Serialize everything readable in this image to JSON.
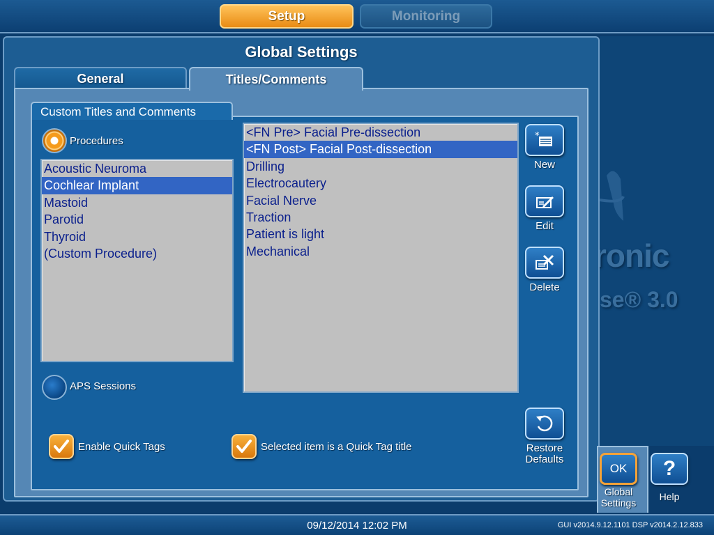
{
  "top_tabs": {
    "setup": "Setup",
    "monitoring": "Monitoring"
  },
  "background": {
    "brand_fragment": "ronic",
    "version_fragment": "se® 3.0"
  },
  "panel": {
    "title": "Global Settings",
    "tabs": {
      "general": "General",
      "titles_comments": "Titles/Comments"
    },
    "group_title": "Custom Titles and Comments"
  },
  "radios": {
    "procedures": "Procedures",
    "aps_sessions": "APS Sessions"
  },
  "procedures": {
    "items": [
      "Acoustic Neuroma",
      "Cochlear Implant",
      "Mastoid",
      "Parotid",
      "Thyroid",
      "(Custom Procedure)"
    ],
    "selected": "Cochlear Implant"
  },
  "titles": {
    "items": [
      "<FN Pre> Facial Pre-dissection",
      "<FN Post> Facial Post-dissection",
      "Drilling",
      "Electrocautery",
      "Facial Nerve",
      "Traction",
      "Patient is light",
      "Mechanical"
    ],
    "selected": "<FN Post> Facial Post-dissection"
  },
  "buttons": {
    "new": "New",
    "edit": "Edit",
    "delete": "Delete",
    "restore_line1": "Restore",
    "restore_line2": "Defaults",
    "ok": "OK",
    "global_line1": "Global",
    "global_line2": "Settings",
    "help_glyph": "?",
    "help": "Help"
  },
  "checkboxes": {
    "enable_quick_tags": "Enable Quick Tags",
    "quick_tag_title": "Selected item is a Quick Tag title"
  },
  "status": {
    "datetime": "09/12/2014 12:02 PM",
    "versions": "GUI v2014.9.12.1101   DSP v2014.2.12.833"
  },
  "colors": {
    "accent": "#f59b1c",
    "background": "#0b3c6c",
    "list_bg": "#c0c0c0",
    "selection": "#3265c4",
    "list_text": "#0a1f8c"
  }
}
